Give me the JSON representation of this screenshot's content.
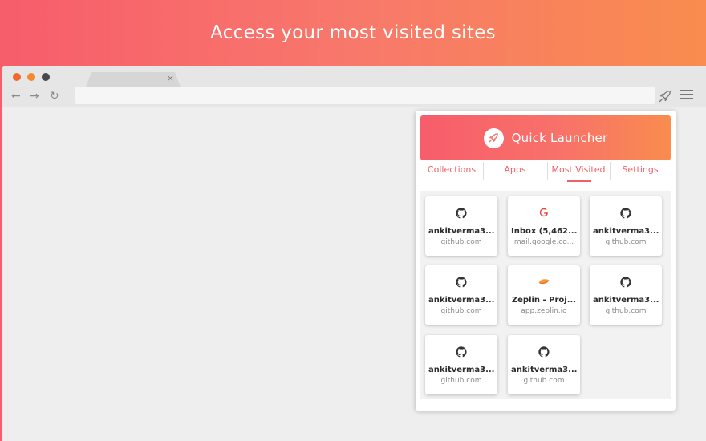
{
  "headline": "Access your most visited sites",
  "colors": {
    "brand_gradient_start": "#f75d6b",
    "brand_gradient_end": "#f98c4e",
    "accent": "#f06069"
  },
  "browser": {
    "tab_close": "×",
    "nav": {
      "back": "←",
      "forward": "→",
      "reload": "↻"
    },
    "extension_icon": "rocket-icon",
    "menu_icon": "hamburger-menu-icon"
  },
  "popup": {
    "title": "Quick Launcher",
    "logo_icon": "rocket-icon",
    "tabs": [
      {
        "label": "Collections",
        "active": false
      },
      {
        "label": "Apps",
        "active": false
      },
      {
        "label": "Most Visited",
        "active": true
      },
      {
        "label": "Settings",
        "active": false
      }
    ],
    "sites": [
      {
        "title": "ankitverma3...",
        "domain": "github.com",
        "icon": "github-icon"
      },
      {
        "title": "Inbox (5,462...",
        "domain": "mail.google.co...",
        "icon": "google-icon"
      },
      {
        "title": "ankitverma3...",
        "domain": "github.com",
        "icon": "github-icon"
      },
      {
        "title": "ankitverma3...",
        "domain": "github.com",
        "icon": "github-icon"
      },
      {
        "title": "Zeplin - Proj...",
        "domain": "app.zeplin.io",
        "icon": "zeplin-icon"
      },
      {
        "title": "ankitverma3...",
        "domain": "github.com",
        "icon": "github-icon"
      },
      {
        "title": "ankitverma3...",
        "domain": "github.com",
        "icon": "github-icon"
      },
      {
        "title": "ankitverma3...",
        "domain": "github.com",
        "icon": "github-icon"
      }
    ]
  }
}
